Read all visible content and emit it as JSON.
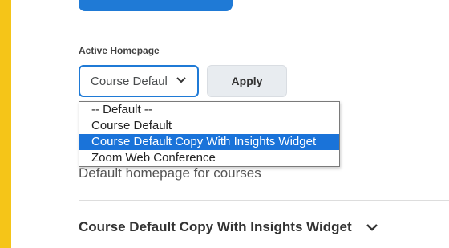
{
  "homepage": {
    "section_label": "Active Homepage",
    "select_value": "Course Default Copy With Insights Widget",
    "apply_label": "Apply",
    "options": [
      "-- Default --",
      "Course Default",
      "Course Default Copy With Insights Widget",
      "Zoom Web Conference"
    ],
    "selected_index": 2,
    "description": "Default homepage for courses"
  },
  "accordion": {
    "title": "Course Default Copy With Insights Widget"
  },
  "colors": {
    "accent": "#1f7ad6",
    "frame": "#f5c518",
    "selected_option": "#1a73d9"
  },
  "icons": {
    "select_chevron": "chevron-down-icon",
    "accordion_chevron": "chevron-down-icon"
  }
}
